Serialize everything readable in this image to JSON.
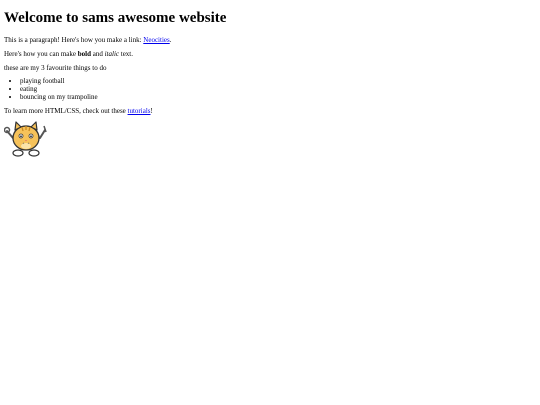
{
  "page": {
    "heading": "Welcome to sams awesome website",
    "para1": {
      "text_before": "This is a paragraph! Here's how you make a link: ",
      "link_text": "Neocities",
      "text_after": "."
    },
    "para2": {
      "text_before": "Here's how you can make ",
      "bold_text": "bold",
      "text_middle": " and ",
      "italic_text": "italic",
      "text_after": " text."
    },
    "list_intro": "these are my 3 favourite things to do",
    "favourites": [
      "playing football",
      "eating",
      "bouncing on my trampoline"
    ],
    "para3": {
      "text_before": "To learn more HTML/CSS, check out these ",
      "link_text": "tutorials",
      "text_after": "!"
    },
    "mascot_icon": "neocities-cat-mascot-icon"
  }
}
